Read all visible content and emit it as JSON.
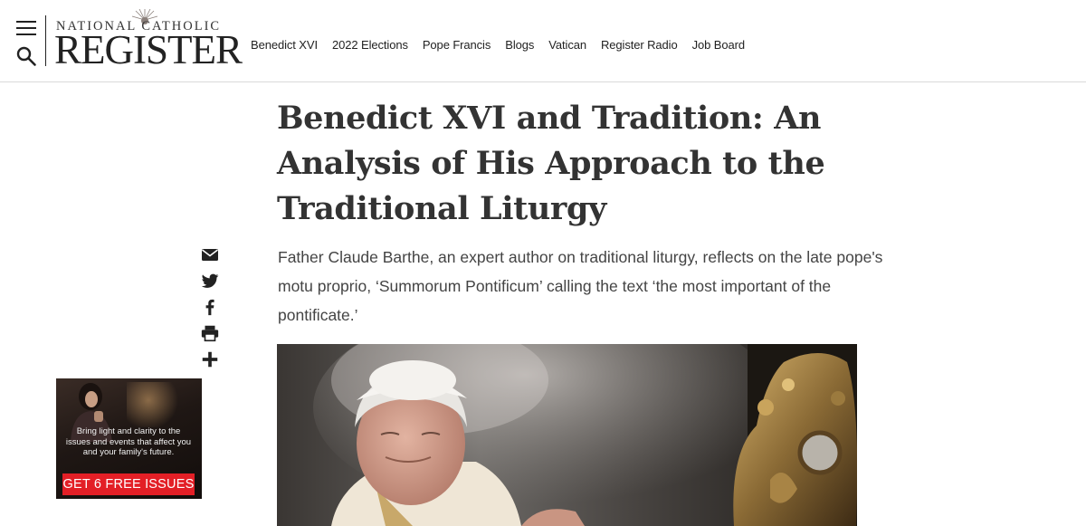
{
  "header": {
    "logo": {
      "line1": "NATIONAL CATHOLIC",
      "line2": "REGISTER"
    },
    "nav": [
      {
        "label": "Benedict XVI"
      },
      {
        "label": "2022 Elections"
      },
      {
        "label": "Pope Francis"
      },
      {
        "label": "Blogs"
      },
      {
        "label": "Vatican"
      },
      {
        "label": "Register Radio"
      },
      {
        "label": "Job Board"
      }
    ],
    "icons": {
      "menu": "hamburger-menu-icon",
      "search": "search-icon"
    }
  },
  "article": {
    "title": "Benedict XVI and Tradition: An Analysis of His Approach to the Traditional Liturgy",
    "subtitle": "Father Claude Barthe, an expert author on traditional liturgy, reflects on the late pope's motu proprio, ‘Summorum Pontificum’ calling the text ‘the most important of the pontificate.’"
  },
  "share": [
    "email-icon",
    "twitter-icon",
    "facebook-icon",
    "print-icon",
    "plus-icon"
  ],
  "ad": {
    "text": "Bring light and clarity to the issues and events that affect you and your family's future.",
    "button": "GET 6 FREE ISSUES"
  },
  "colors": {
    "ad_button": "#e31f26",
    "text": "#333333",
    "divider": "#d9d9d9"
  }
}
